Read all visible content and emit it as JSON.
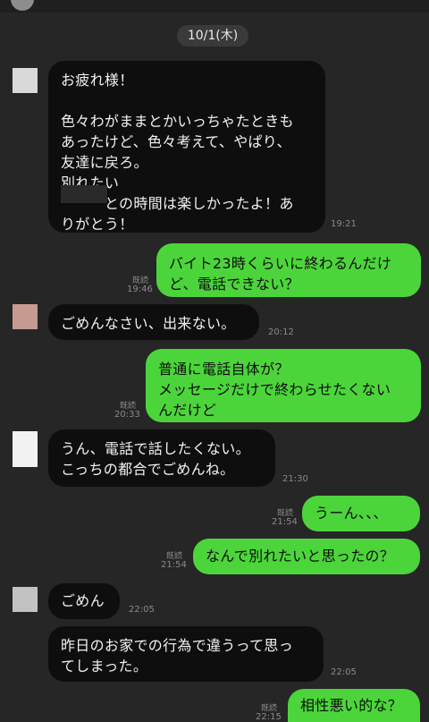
{
  "date_separator": "10/1(木)",
  "messages": [
    {
      "side": "in",
      "text": "お疲れ様！\n\n色々わがままとかいっちゃたときも\nあったけど、色々考えて、やぱり、\n友達に戻ろ。\n別れたい\n　　　との時間は楽しかったよ！あ\nりがとう！",
      "time": "19:21"
    },
    {
      "side": "out",
      "text": "バイト23時くらいに終わるんだけ\nど、電話できない？",
      "time": "19:46",
      "read": "既読"
    },
    {
      "side": "in",
      "text": "ごめんなさい、出来ない。",
      "time": "20:12"
    },
    {
      "side": "out",
      "text": "普通に電話自体が？\nメッセージだけで終わらせたくない\nんだけど",
      "time": "20:33",
      "read": "既読"
    },
    {
      "side": "in",
      "text": "うん、電話で話したくない。\nこっちの都合でごめんね。",
      "time": "21:30"
    },
    {
      "side": "out",
      "text": "うーん、、、",
      "time": "21:54",
      "read": "既読"
    },
    {
      "side": "out",
      "text": "なんで別れたいと思ったの？",
      "time": "21:54",
      "read": "既読"
    },
    {
      "side": "in",
      "text": "ごめん",
      "time": "22:05"
    },
    {
      "side": "in",
      "text": "昨日のお家での行為で違うって思っ\nてしまった。",
      "time": "22:05"
    },
    {
      "side": "out",
      "text": "相性悪い的な？",
      "time": "22:15",
      "read": "既読"
    }
  ],
  "colors": {
    "background": "#262626",
    "incoming_bubble": "#0e0e0e",
    "outgoing_bubble": "#4cd53b"
  }
}
